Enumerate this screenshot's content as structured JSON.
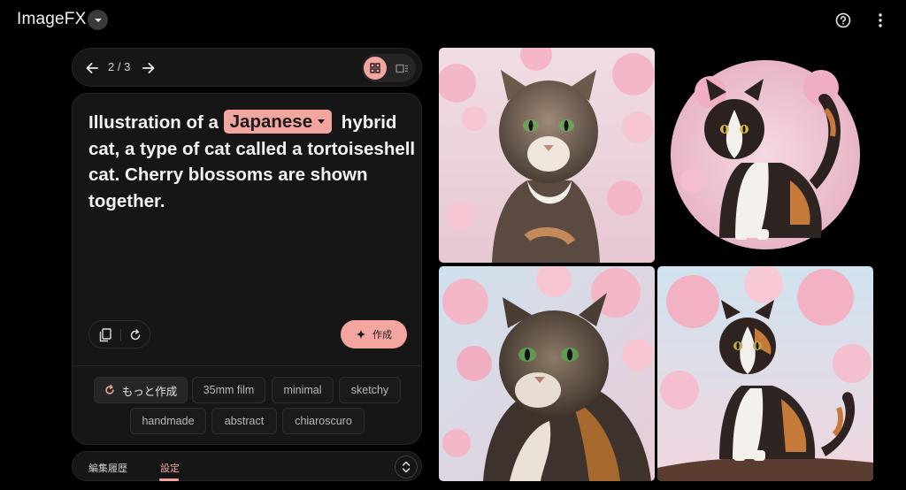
{
  "app": {
    "title": "ImageFX",
    "title_menu_icon": "chevron-down-icon",
    "help_icon": "help-circle-icon",
    "more_icon": "more-vert-icon"
  },
  "pager": {
    "counter": "2 / 3",
    "prev_icon": "arrow-left-icon",
    "next_icon": "arrow-right-icon",
    "grid_view_icon": "grid-view-icon",
    "single_view_icon": "single-view-icon",
    "active_view": "grid"
  },
  "prompt": {
    "before": "Illustration of a",
    "chip": "Japanese",
    "after": "hybrid cat, a type of cat called a tortoiseshell cat. Cherry blossoms are shown together."
  },
  "actions": {
    "copy_icon": "copy-icon",
    "reset_icon": "refresh-icon",
    "create_label": "作成",
    "create_icon": "sparkle-icon"
  },
  "suggestions": {
    "more_label": "もっと作成",
    "more_icon": "refresh-icon",
    "chips": [
      "35mm film",
      "minimal",
      "sketchy",
      "handmade",
      "abstract",
      "chiaroscuro"
    ]
  },
  "bottom": {
    "history_label": "編集履歴",
    "settings_label": "設定",
    "active_tab": "settings",
    "expand_icon": "unfold-icon"
  },
  "gallery": {
    "count": 4,
    "images": [
      {
        "subject": "tabby-cat-cherry-blossoms"
      },
      {
        "subject": "calico-cat-in-circle"
      },
      {
        "subject": "tabby-cat-closeup-cherry-blossoms"
      },
      {
        "subject": "calico-cat-on-branch"
      }
    ]
  },
  "colors": {
    "background": "#000000",
    "panel": "#161616",
    "accent": "#f3a5a0",
    "text": "#f2f2f2"
  }
}
